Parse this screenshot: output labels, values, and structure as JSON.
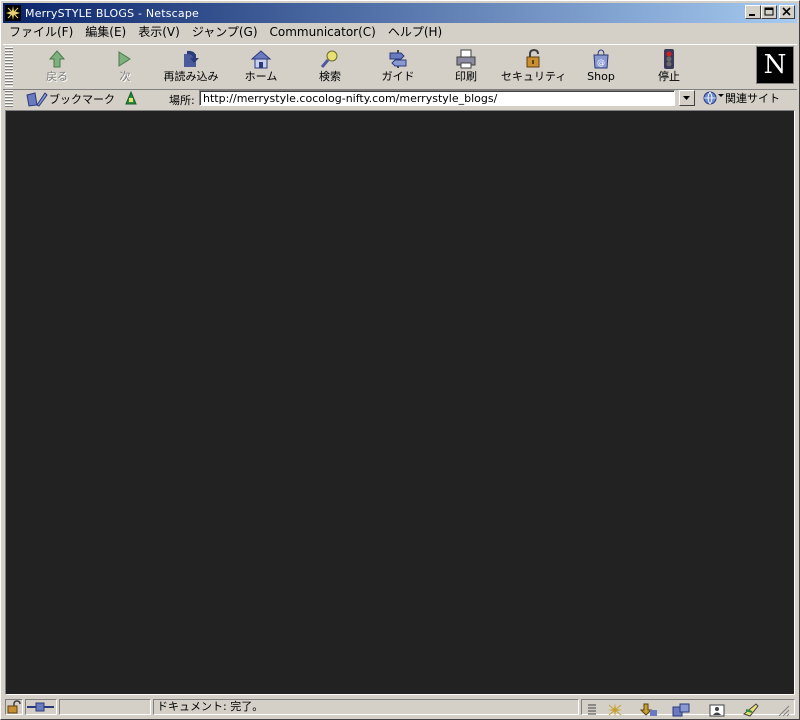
{
  "window": {
    "title": "MerrySTYLE BLOGS - Netscape"
  },
  "menu": [
    {
      "label": "ファイル(F)"
    },
    {
      "label": "編集(E)"
    },
    {
      "label": "表示(V)"
    },
    {
      "label": "ジャンプ(G)"
    },
    {
      "label": "Communicator(C)"
    },
    {
      "label": "ヘルプ(H)"
    }
  ],
  "toolbar": {
    "back": "戻る",
    "forward": "次",
    "reload": "再読み込み",
    "home": "ホーム",
    "search": "検索",
    "guide": "ガイド",
    "print": "印刷",
    "security": "セキュリティ",
    "shop": "Shop",
    "stop": "停止",
    "logo_letter": "N"
  },
  "location": {
    "bookmarks_label": "ブックマーク",
    "label": "場所:",
    "url": "http://merrystyle.cocolog-nifty.com/merrystyle_blogs/",
    "related_label": "関連サイト"
  },
  "status": {
    "text": "ドキュメント: 完了。"
  },
  "colors": {
    "content_bg": "#222222",
    "title_start": "#0a246a",
    "title_end": "#a6caf0"
  }
}
